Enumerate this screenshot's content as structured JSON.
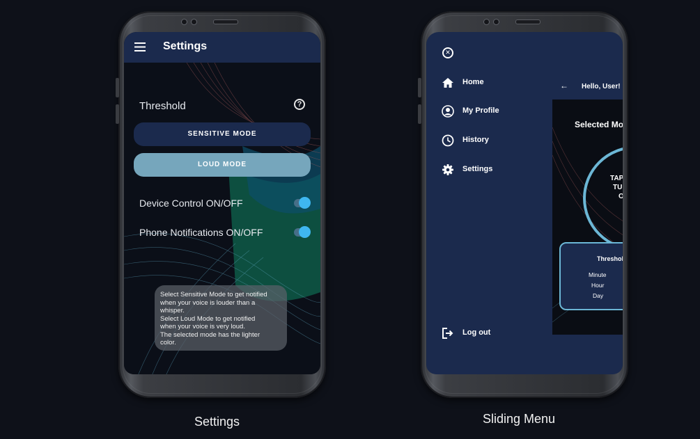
{
  "settings_phone": {
    "title": "Settings",
    "threshold_label": "Threshold",
    "help_glyph": "?",
    "sensitive_mode_label": "SENSITIVE MODE",
    "loud_mode_label": "LOUD MODE",
    "device_control_label": "Device Control ON/OFF",
    "phone_notifications_label": "Phone Notifications ON/OFF",
    "device_control_on": true,
    "phone_notifications_on": true,
    "hint_text": "Select Sensitive Mode to get notified\nwhen your voice is louder than a\nwhisper.\nSelect Loud Mode to get notified\nwhen your voice is very loud.\nThe selected mode has the lighter\ncolor.",
    "colors": {
      "topbar": "#1b2a4d",
      "sensitive_button": "#1b2a4d",
      "loud_button": "#76a6bc",
      "toggle_knob": "#3fb7f0"
    }
  },
  "menu_phone": {
    "close_glyph": "×",
    "items": [
      {
        "label": "Home",
        "icon": "home-icon"
      },
      {
        "label": "My Profile",
        "icon": "profile-icon"
      },
      {
        "label": "History",
        "icon": "clock-icon"
      },
      {
        "label": "Settings",
        "icon": "gear-icon"
      }
    ],
    "logout_label": "Log out",
    "behind": {
      "back_glyph": "←",
      "greeting": "Hello, User!",
      "selected_mode": "Selected Mo",
      "circle_lines": [
        "TAP",
        "TU",
        "O"
      ],
      "threshold_title": "Threshol",
      "rows": [
        "Minute",
        "Hour",
        "Day"
      ]
    },
    "colors": {
      "drawer": "#1b2a4d",
      "accent": "#6cb7d6"
    }
  },
  "captions": {
    "left": "Settings",
    "right": "Sliding Menu"
  }
}
